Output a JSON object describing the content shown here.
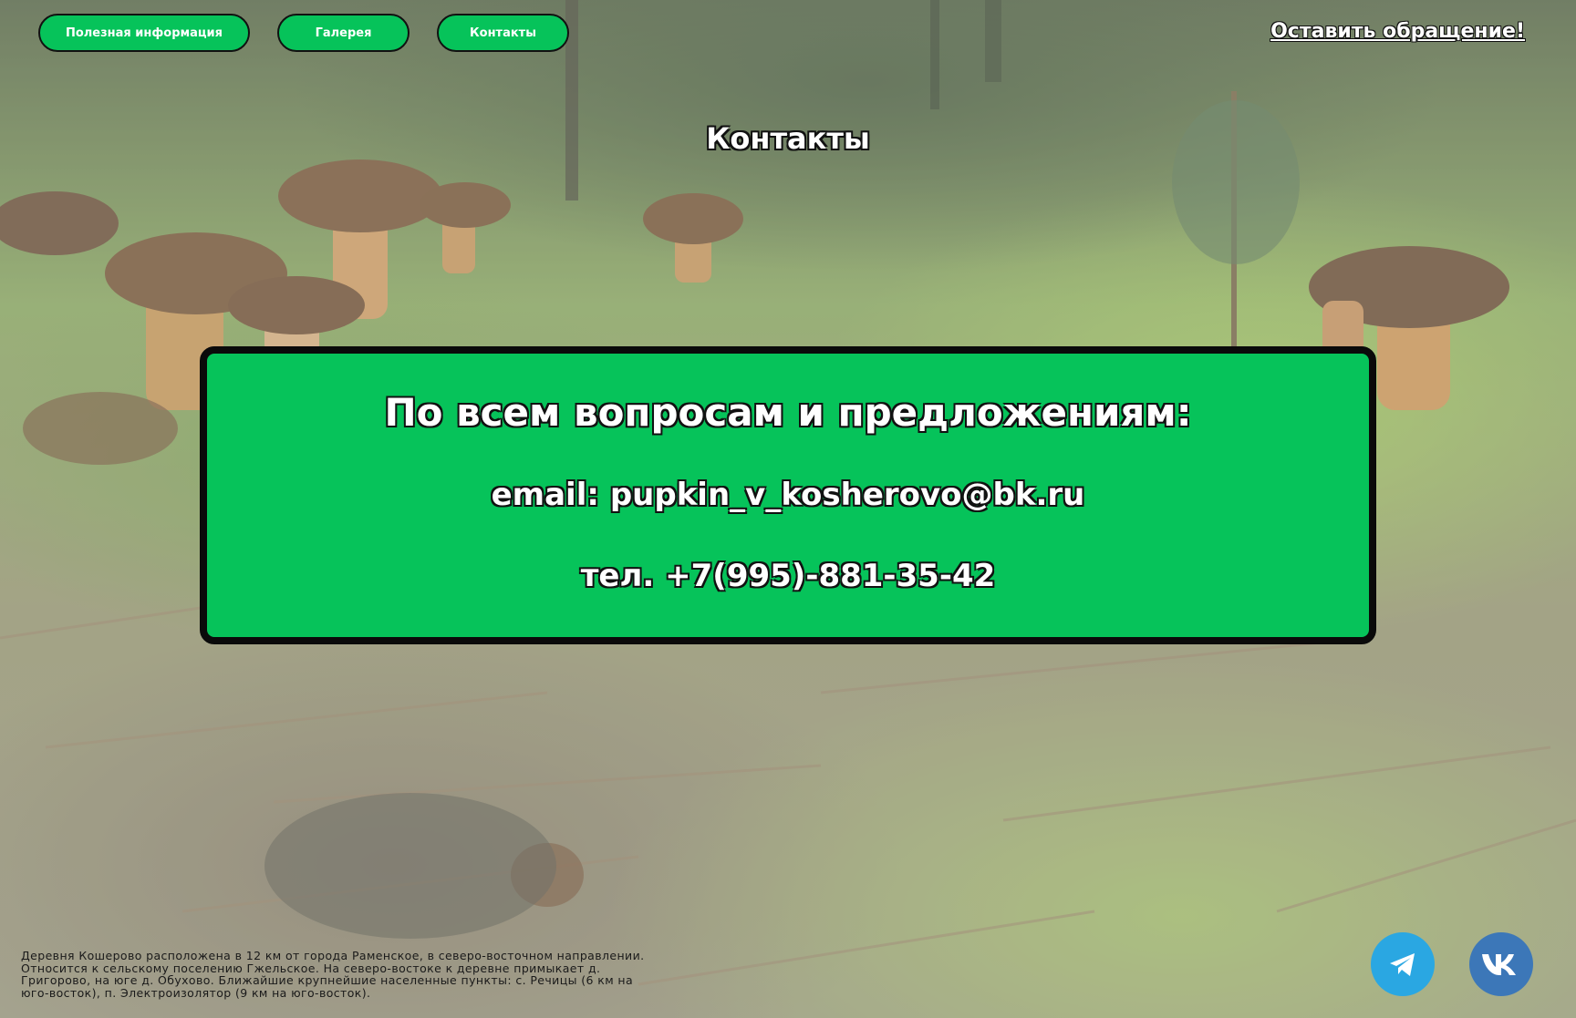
{
  "nav": {
    "items": [
      {
        "label": "Полезная информация"
      },
      {
        "label": "Галерея"
      },
      {
        "label": "Контакты"
      }
    ]
  },
  "header": {
    "cta_label": "Оставить обращение!"
  },
  "main": {
    "title": "Контакты",
    "card": {
      "heading": "По всем вопросам и предложениям:",
      "email_label": "email:",
      "email": "pupkin_v_kosherovo@bk.ru",
      "phone": "тел. +7(995)-881-35-42"
    }
  },
  "footer": {
    "description": "Деревня Кошерово расположена в 12 км от города Раменское, в северо-восточном направлении. Относится к сельскому поселению Гжельское. На северо-востоке к деревне примыкает д. Григорово, на юге д. Обухово. Ближайшие крупнейшие населенные пункты: с. Речицы (6 км на юго-восток), п. Электроизолятор (9 км на юго-восток).",
    "social": [
      {
        "icon": "telegram-icon"
      },
      {
        "icon": "vk-icon"
      }
    ]
  },
  "colors": {
    "accent": "#06c35a",
    "border": "#0a0a0a",
    "telegram": "#2aa7e2",
    "vk": "#3c77b8"
  }
}
